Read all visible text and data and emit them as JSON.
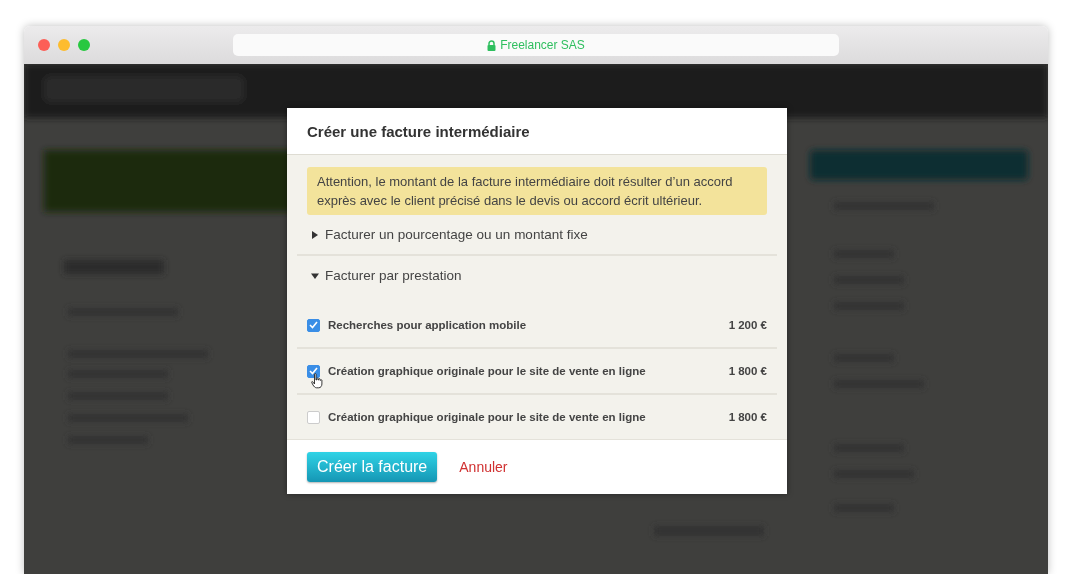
{
  "browser": {
    "address": "Freelancer SAS",
    "secure": true
  },
  "dialog": {
    "title": "Créer une facture intermédiaire",
    "warning": "Attention, le montant de la facture intermédiaire doit résulter d’un accord exprès avec le client précisé dans le devis ou accord écrit ultérieur.",
    "sections": [
      {
        "label": "Facturer un pourcentage ou un montant fixe",
        "expanded": false
      },
      {
        "label": "Facturer par prestation",
        "expanded": true,
        "items": [
          {
            "label": "Recherches pour application mobile",
            "amount": "1 200 €",
            "checked": true,
            "hovered": false
          },
          {
            "label": "Création graphique originale pour le site de vente en ligne",
            "amount": "1 800 €",
            "checked": true,
            "hovered": true
          },
          {
            "label": "Création graphique originale pour le site de vente en ligne",
            "amount": "1 800 €",
            "checked": false,
            "hovered": false
          }
        ]
      }
    ],
    "buttons": {
      "primary": "Créer la facture",
      "cancel": "Annuler"
    }
  }
}
